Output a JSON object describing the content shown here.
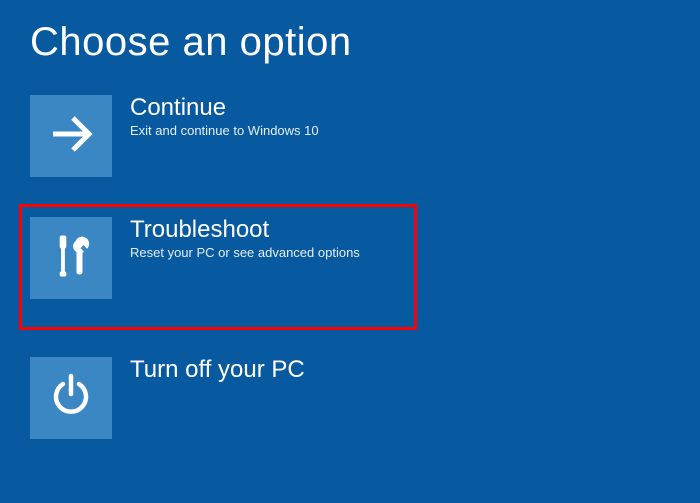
{
  "page_title": "Choose an option",
  "options": [
    {
      "title": "Continue",
      "subtitle": "Exit and continue to Windows 10"
    },
    {
      "title": "Troubleshoot",
      "subtitle": "Reset your PC or see advanced options"
    },
    {
      "title": "Turn off your PC",
      "subtitle": ""
    }
  ],
  "colors": {
    "background": "#085aa0",
    "tile": "#3a87c3",
    "highlight": "#ff0000"
  }
}
